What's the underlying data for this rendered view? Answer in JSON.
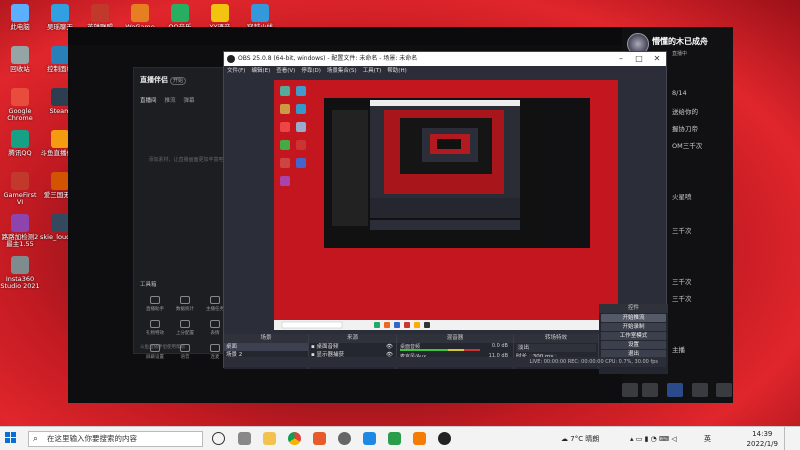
{
  "desktop_icons": [
    "此电脑",
    "吴瑶聊天",
    "英雄联盟",
    "WeGame",
    "QQ音乐",
    "YY语音",
    "穿越火线",
    "回收站",
    "控制面板",
    "Google Chrome",
    "Steam",
    "腾讯QQ",
    "斗鱼直播伴侣",
    "GameFirst VI",
    "爱三国无双",
    "路路加检测2最主1.55",
    "skie_loudness",
    "Insta360 Studio 2021"
  ],
  "live_app": {
    "title": "直播伴侣",
    "tag": "开始",
    "tabs": [
      "直播间",
      "推流",
      "弹幕"
    ],
    "hint": "添加素材，让直播画面更加丰富吧",
    "tools_title": "工具箱",
    "tools": [
      "直播助手",
      "数据统计",
      "主播任务",
      "礼物特效",
      "上分配置",
      "表情",
      "屏蔽设置",
      "语音",
      "连麦"
    ],
    "footer": "斗鱼直播伴侣使用帮助"
  },
  "chat": {
    "username": "懵懂的木已成舟",
    "sub": "直播中",
    "lines": [
      "8/14",
      "送给你的",
      "握协刀帝",
      "OM三千次",
      "",
      "",
      "火星喷",
      "",
      "三千次",
      "",
      "",
      "三千次",
      "三千次",
      "",
      "",
      "主播"
    ]
  },
  "obs": {
    "title": "OBS 25.0.8 (64-bit, windows) - 配置文件: 未命名 - 场景: 未命名",
    "menu": [
      "文件(F)",
      "编辑(E)",
      "查看(V)",
      "停靠(D)",
      "场景集合(S)",
      "工具(T)",
      "帮助(H)"
    ],
    "docks": {
      "scenes": {
        "title": "场景",
        "items": [
          "桌面",
          "场景 2"
        ]
      },
      "sources": {
        "title": "来源",
        "items": [
          "桌面音频",
          "显示器捕获"
        ]
      },
      "mixer": {
        "title": "混音器",
        "channels": [
          {
            "name": "桌面音频",
            "db": "0.0 dB"
          },
          {
            "name": "麦克风/Aux",
            "db": "11.0 dB"
          },
          {
            "name": "麦克风/Aux 2",
            "db": "0.0 dB"
          }
        ]
      },
      "transitions": {
        "title": "转场特效",
        "type": "淡出",
        "duration_label": "时长",
        "duration": "300 ms"
      },
      "controls": {
        "title": "控件",
        "buttons": [
          "开始推流",
          "开始录制",
          "工作室模式",
          "设置",
          "退出"
        ]
      }
    },
    "status": "LIVE: 00:00:00   REC: 00:00:00   CPU: 0.7%, 30.00 fps"
  },
  "taskbar": {
    "search_placeholder": "在这里输入你要搜索的内容",
    "weather": "7°C 晴朗",
    "ime": "英",
    "time": "14:39",
    "date": "2022/1/9"
  }
}
